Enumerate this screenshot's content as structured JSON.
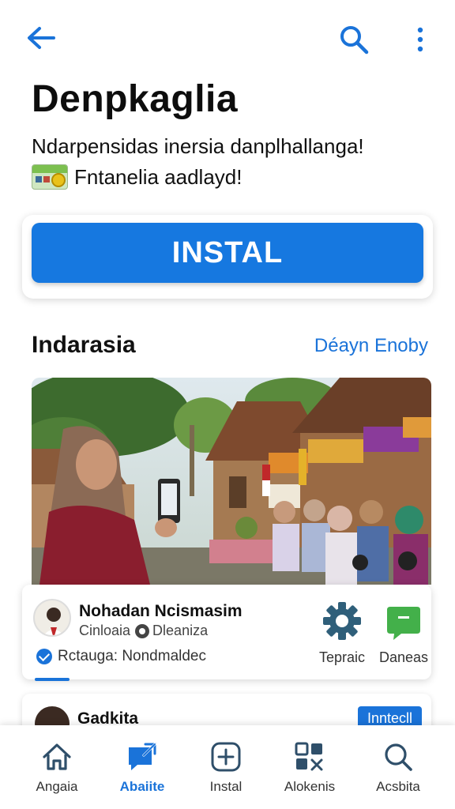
{
  "topbar": {
    "back_icon": "arrow-left-icon",
    "search_icon": "search-icon",
    "more_icon": "more-vertical-icon"
  },
  "app": {
    "title": "Denpkaglia",
    "tagline": "Ndarpensidas inersia danplhallanga!",
    "subline": "Fntanelia aadlayd!",
    "sub_icon": "voucher-card-icon"
  },
  "install": {
    "label": "INSTAL"
  },
  "section": {
    "title": "Indarasia",
    "link": "Déayn Enoby"
  },
  "featured": {
    "photo_description_icon": "community-photo-image",
    "profile_name": "Nohadan Ncismasim",
    "profile_meta_left": "Cinloaia",
    "profile_meta_right": "Dleaniza",
    "verified_text": "Rctauga: Nondmaldec",
    "action_a_label": "Tepraic",
    "action_a_icon": "gear-icon",
    "action_b_label": "Daneas",
    "action_b_icon": "chat-bubble-icon"
  },
  "mini_card": {
    "title": "Gadkita",
    "badge": "Inntecll"
  },
  "nav": {
    "items": [
      {
        "label": "Angaia",
        "icon": "home-icon"
      },
      {
        "label": "Abaiite",
        "icon": "share-message-icon"
      },
      {
        "label": "Instal",
        "icon": "plus-square-icon"
      },
      {
        "label": "Alokenis",
        "icon": "apps-grid-icon"
      },
      {
        "label": "Acsbita",
        "icon": "search-icon"
      }
    ],
    "active_index": 1
  },
  "colors": {
    "accent": "#1678e0",
    "link": "#1a73d9",
    "text": "#111111"
  }
}
